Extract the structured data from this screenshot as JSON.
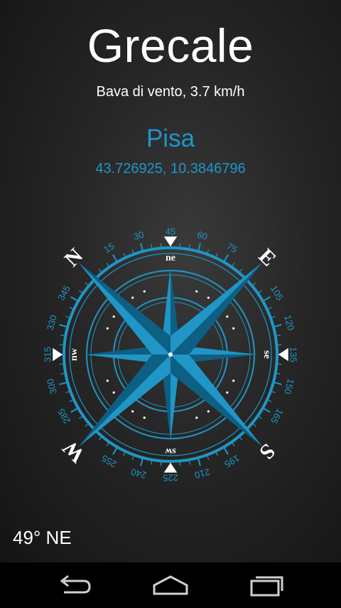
{
  "wind": {
    "name": "Grecale",
    "description": "Bava di vento, 3.7 km/h"
  },
  "location": {
    "city": "Pisa",
    "coordinates": "43.726925, 10.3846796"
  },
  "compass": {
    "heading_deg": 49,
    "cardinals": [
      {
        "label": "N",
        "angle": -45
      },
      {
        "label": "E",
        "angle": 45
      },
      {
        "label": "S",
        "angle": 135
      },
      {
        "label": "W",
        "angle": 225
      }
    ],
    "intercardinals": [
      {
        "label": "ne",
        "angle": 0
      },
      {
        "label": "se",
        "angle": 90
      },
      {
        "label": "sw",
        "angle": 180
      },
      {
        "label": "nw",
        "angle": 270
      }
    ],
    "degree_labels": [
      "15",
      "30",
      "45",
      "60",
      "75",
      "105",
      "120",
      "135",
      "150",
      "165",
      "195",
      "210",
      "225",
      "240",
      "255",
      "285",
      "300",
      "315",
      "330",
      "345"
    ]
  },
  "heading_text": "49° NE",
  "colors": {
    "accent": "#1f96c6",
    "accent_dark": "#0d5f84",
    "text": "#ffffff",
    "background": "#1e1e1e"
  },
  "navbar": {
    "back_icon": "back-icon",
    "home_icon": "home-icon",
    "recents_icon": "recents-icon"
  }
}
